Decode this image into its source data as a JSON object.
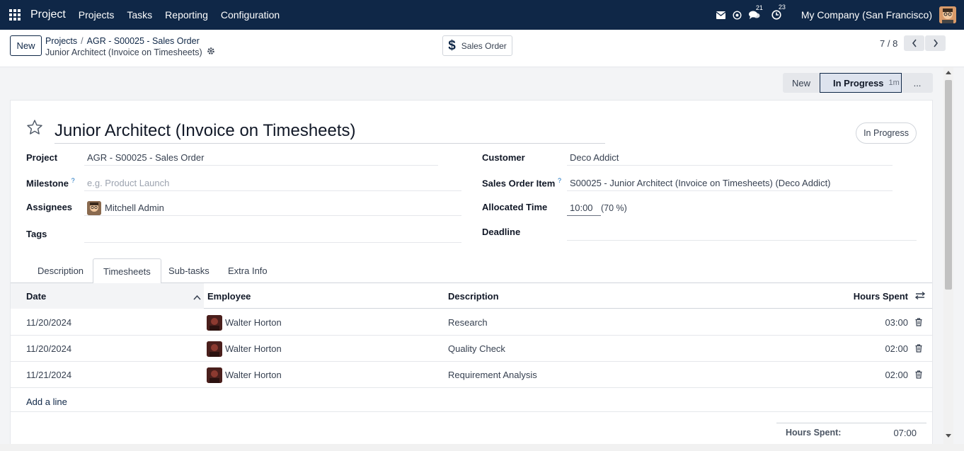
{
  "navbar": {
    "app": "Project",
    "menus": [
      "Projects",
      "Tasks",
      "Reporting",
      "Configuration"
    ],
    "messages_badge": "21",
    "activities_badge": "23",
    "company": "My Company (San Francisco)"
  },
  "control": {
    "new_label": "New",
    "breadcrumb": [
      "Projects",
      "AGR - S00025 - Sales Order"
    ],
    "record_name": "Junior Architect (Invoice on Timesheets)",
    "smart_button": "Sales Order",
    "pager": "7 / 8"
  },
  "statusbar": {
    "stages": [
      "New",
      "In Progress",
      "..."
    ],
    "active_duration": "1m"
  },
  "form": {
    "title": "Junior Architect (Invoice on Timesheets)",
    "state": "In Progress",
    "project_label": "Project",
    "project": "AGR - S00025 - Sales Order",
    "milestone_label": "Milestone",
    "milestone_placeholder": "e.g. Product Launch",
    "assignees_label": "Assignees",
    "assignee": "Mitchell Admin",
    "tags_label": "Tags",
    "customer_label": "Customer",
    "customer": "Deco Addict",
    "so_item_label": "Sales Order Item",
    "so_item": "S00025 - Junior Architect (Invoice on Timesheets) (Deco Addict)",
    "allocated_label": "Allocated Time",
    "allocated_time": "10:00",
    "allocated_pct": "(70 %)",
    "deadline_label": "Deadline",
    "help_mark": "?"
  },
  "tabs": [
    "Description",
    "Timesheets",
    "Sub-tasks",
    "Extra Info"
  ],
  "timesheets": {
    "columns": [
      "Date",
      "Employee",
      "Description",
      "Hours Spent"
    ],
    "rows": [
      {
        "date": "11/20/2024",
        "employee": "Walter Horton",
        "description": "Research",
        "hours": "03:00"
      },
      {
        "date": "11/20/2024",
        "employee": "Walter Horton",
        "description": "Quality Check",
        "hours": "02:00"
      },
      {
        "date": "11/21/2024",
        "employee": "Walter Horton",
        "description": "Requirement Analysis",
        "hours": "02:00"
      }
    ],
    "add_line": "Add a line",
    "total_label": "Hours Spent:",
    "total_value": "07:00"
  }
}
